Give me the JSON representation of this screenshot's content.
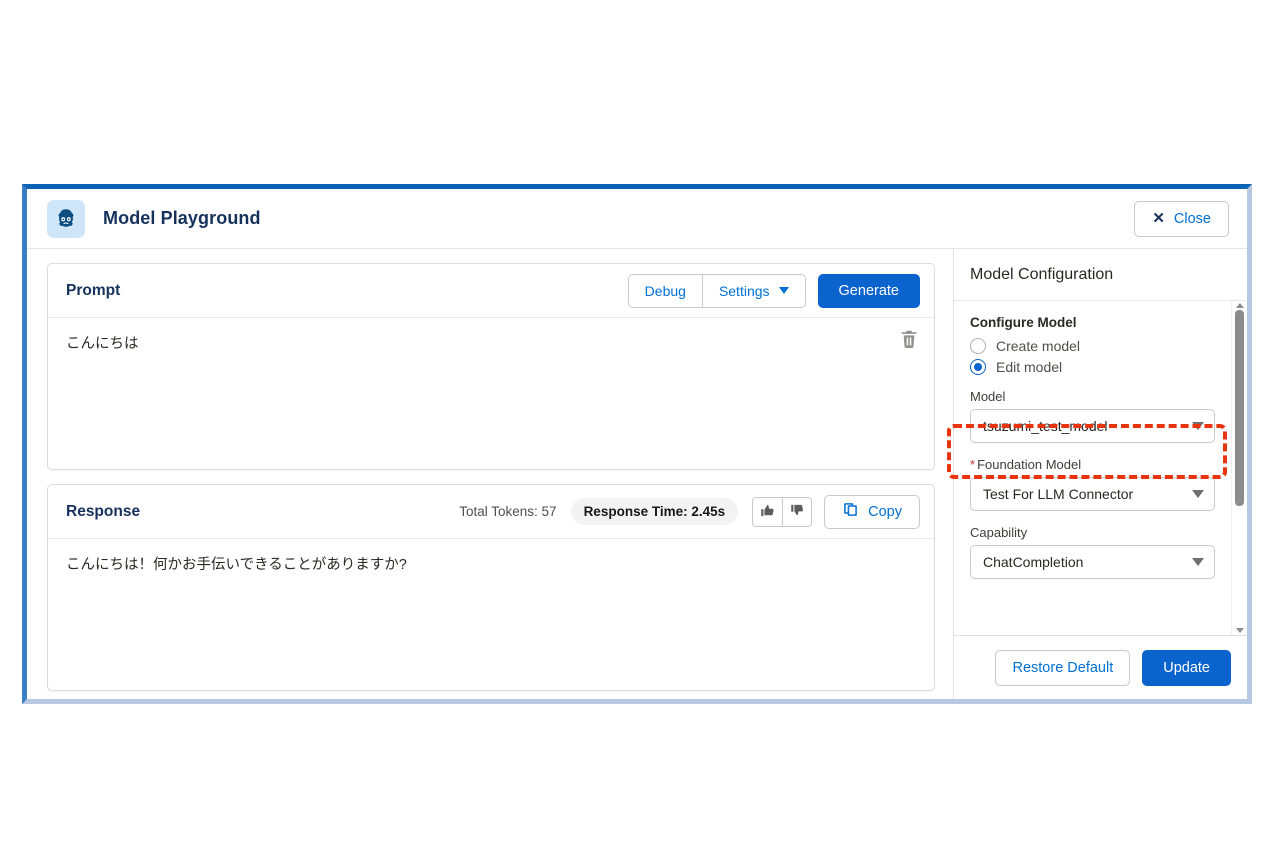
{
  "window": {
    "title": "Model Playground",
    "app_icon": "einstein-avatar-icon",
    "close_label": "Close",
    "close_icon": "close-x-icon",
    "border_color": "#0b63b5"
  },
  "prompt_card": {
    "title": "Prompt",
    "debug_label": "Debug",
    "settings_label": "Settings",
    "settings_caret_icon": "chevron-down-icon",
    "generate_label": "Generate",
    "delete_icon": "trash-icon",
    "text": "こんにちは"
  },
  "response_card": {
    "title": "Response",
    "total_tokens_label": "Total Tokens: 57",
    "response_time_label": "Response Time: 2.45s",
    "thumbs_up_icon": "thumbs-up-icon",
    "thumbs_down_icon": "thumbs-down-icon",
    "copy_label": "Copy",
    "copy_icon": "copy-icon",
    "text": "こんにちは！何かお手伝いできることがありますか?"
  },
  "config_panel": {
    "header": "Model Configuration",
    "section_label": "Configure Model",
    "radios": [
      {
        "label": "Create model",
        "checked": false
      },
      {
        "label": "Edit model",
        "checked": true
      }
    ],
    "fields": [
      {
        "label": "Model",
        "required": false,
        "value": "tsuzumi_test_model",
        "highlighted": true
      },
      {
        "label": "Foundation Model",
        "required": true,
        "value": "Test For LLM Connector",
        "highlighted": false
      },
      {
        "label": "Capability",
        "required": false,
        "value": "ChatCompletion",
        "highlighted": false
      }
    ],
    "restore_default_label": "Restore Default",
    "update_label": "Update",
    "scrollbar": {
      "up_icon": "scroll-up-arrow-icon",
      "down_icon": "scroll-down-arrow-icon"
    }
  },
  "annotation": {
    "highlight_color": "#e8330f",
    "target": "model-select"
  }
}
